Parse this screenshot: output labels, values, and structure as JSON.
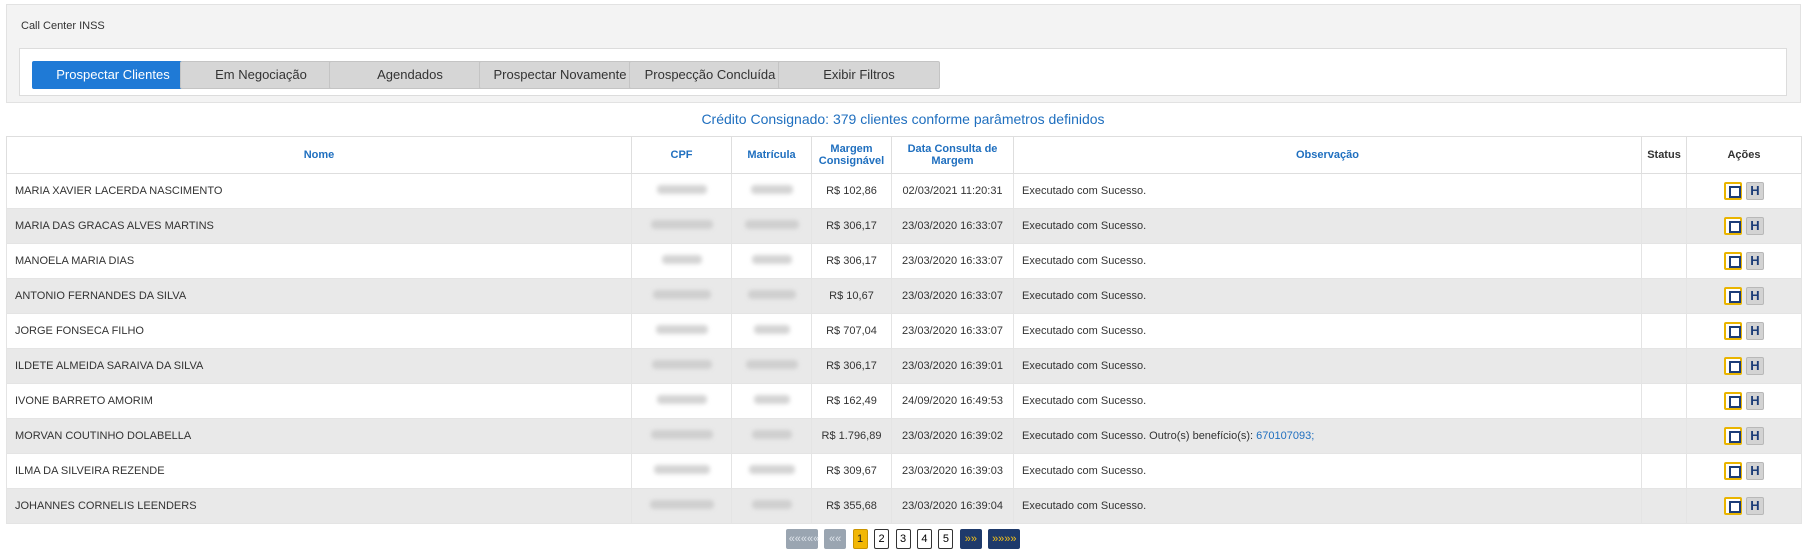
{
  "panel": {
    "title": "Call Center INSS"
  },
  "tabs": [
    {
      "label": "Prospectar Clientes",
      "active": true
    },
    {
      "label": "Em Negociação",
      "active": false
    },
    {
      "label": "Agendados",
      "active": false
    },
    {
      "label": "Prospectar Novamente",
      "active": false
    },
    {
      "label": "Prospecção Concluída",
      "active": false
    },
    {
      "label": "Exibir Filtros",
      "active": false
    }
  ],
  "summary": "Crédito Consignado: 379 clientes conforme parâmetros definidos",
  "table": {
    "headers": {
      "nome": "Nome",
      "cpf": "CPF",
      "matricula": "Matrícula",
      "margem": "Margem Consignável",
      "data": "Data Consulta de Margem",
      "obs": "Observação",
      "status": "Status",
      "acoes": "Ações"
    },
    "rows": [
      {
        "nome": "MARIA XAVIER LACERDA NASCIMENTO",
        "margem": "R$ 102,86",
        "data": "02/03/2021 11:20:31",
        "obs": "Executado com Sucesso.",
        "obs_link": "",
        "status": ""
      },
      {
        "nome": "MARIA DAS GRACAS ALVES MARTINS",
        "margem": "R$ 306,17",
        "data": "23/03/2020 16:33:07",
        "obs": "Executado com Sucesso.",
        "obs_link": "",
        "status": ""
      },
      {
        "nome": "MANOELA MARIA DIAS",
        "margem": "R$ 306,17",
        "data": "23/03/2020 16:33:07",
        "obs": "Executado com Sucesso.",
        "obs_link": "",
        "status": ""
      },
      {
        "nome": "ANTONIO FERNANDES DA SILVA",
        "margem": "R$ 10,67",
        "data": "23/03/2020 16:33:07",
        "obs": "Executado com Sucesso.",
        "obs_link": "",
        "status": ""
      },
      {
        "nome": "JORGE FONSECA FILHO",
        "margem": "R$ 707,04",
        "data": "23/03/2020 16:33:07",
        "obs": "Executado com Sucesso.",
        "obs_link": "",
        "status": ""
      },
      {
        "nome": "ILDETE ALMEIDA SARAIVA DA SILVA",
        "margem": "R$ 306,17",
        "data": "23/03/2020 16:39:01",
        "obs": "Executado com Sucesso.",
        "obs_link": "",
        "status": ""
      },
      {
        "nome": "IVONE BARRETO AMORIM",
        "margem": "R$ 162,49",
        "data": "24/09/2020 16:49:53",
        "obs": "Executado com Sucesso.",
        "obs_link": "",
        "status": ""
      },
      {
        "nome": "MORVAN COUTINHO DOLABELLA",
        "margem": "R$ 1.796,89",
        "data": "23/03/2020 16:39:02",
        "obs": "Executado com Sucesso. Outro(s) benefício(s):",
        "obs_link": "670107093;",
        "status": ""
      },
      {
        "nome": "ILMA DA SILVEIRA REZENDE",
        "margem": "R$ 309,67",
        "data": "23/03/2020 16:39:03",
        "obs": "Executado com Sucesso.",
        "obs_link": "",
        "status": ""
      },
      {
        "nome": "JOHANNES CORNELIS LEENDERS",
        "margem": "R$ 355,68",
        "data": "23/03/2020 16:39:04",
        "obs": "Executado com Sucesso.",
        "obs_link": "",
        "status": ""
      }
    ]
  },
  "pager": {
    "first": "«««««",
    "prev": "««",
    "pages": [
      "1",
      "2",
      "3",
      "4",
      "5"
    ],
    "current": "1",
    "next": "»»",
    "last": "»»»»"
  },
  "icons": {
    "edit": "edit-icon",
    "history": "h-icon"
  },
  "colors": {
    "accent": "#1f7ad6",
    "link": "#1f6fbf",
    "highlight": "#f2b705",
    "navy": "#1e3a6b"
  }
}
